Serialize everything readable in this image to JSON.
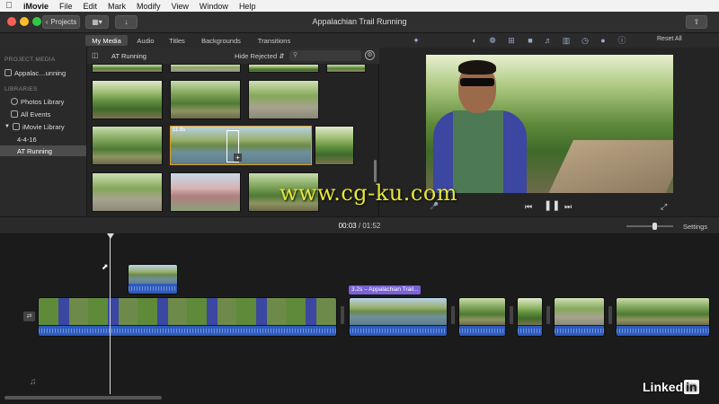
{
  "menubar": {
    "apple": "",
    "items": [
      "iMovie",
      "File",
      "Edit",
      "Mark",
      "Modify",
      "View",
      "Window",
      "Help"
    ]
  },
  "toolbar": {
    "projects_label": "Projects",
    "title": "Appalachian Trail Running"
  },
  "tabs": [
    "My Media",
    "Audio",
    "Titles",
    "Backgrounds",
    "Transitions"
  ],
  "adjust": {
    "reset_all": "Reset All"
  },
  "sidebar": {
    "project_media_heading": "PROJECT MEDIA",
    "project_item": "Appalac…unning",
    "libraries_heading": "LIBRARIES",
    "items": [
      "Photos Library",
      "All Events",
      "iMovie Library",
      "4-4-16",
      "AT Running"
    ]
  },
  "browser": {
    "title": "AT Running",
    "filter": "Hide Rejected",
    "search_placeholder": "",
    "selected_clip_duration": "11.9s"
  },
  "viewer": {
    "watermark": "www.cg-ku.com"
  },
  "timeline": {
    "current": "00:03",
    "separator": "/",
    "total": "01:52",
    "settings": "Settings",
    "title_chip": "3.2s – Appalachian Trail..."
  },
  "branding": {
    "linkedin_text": "Linked",
    "linkedin_in": "in"
  },
  "colors": {
    "accent": "#2f5bbb",
    "title_clip": "#7b62d8"
  }
}
